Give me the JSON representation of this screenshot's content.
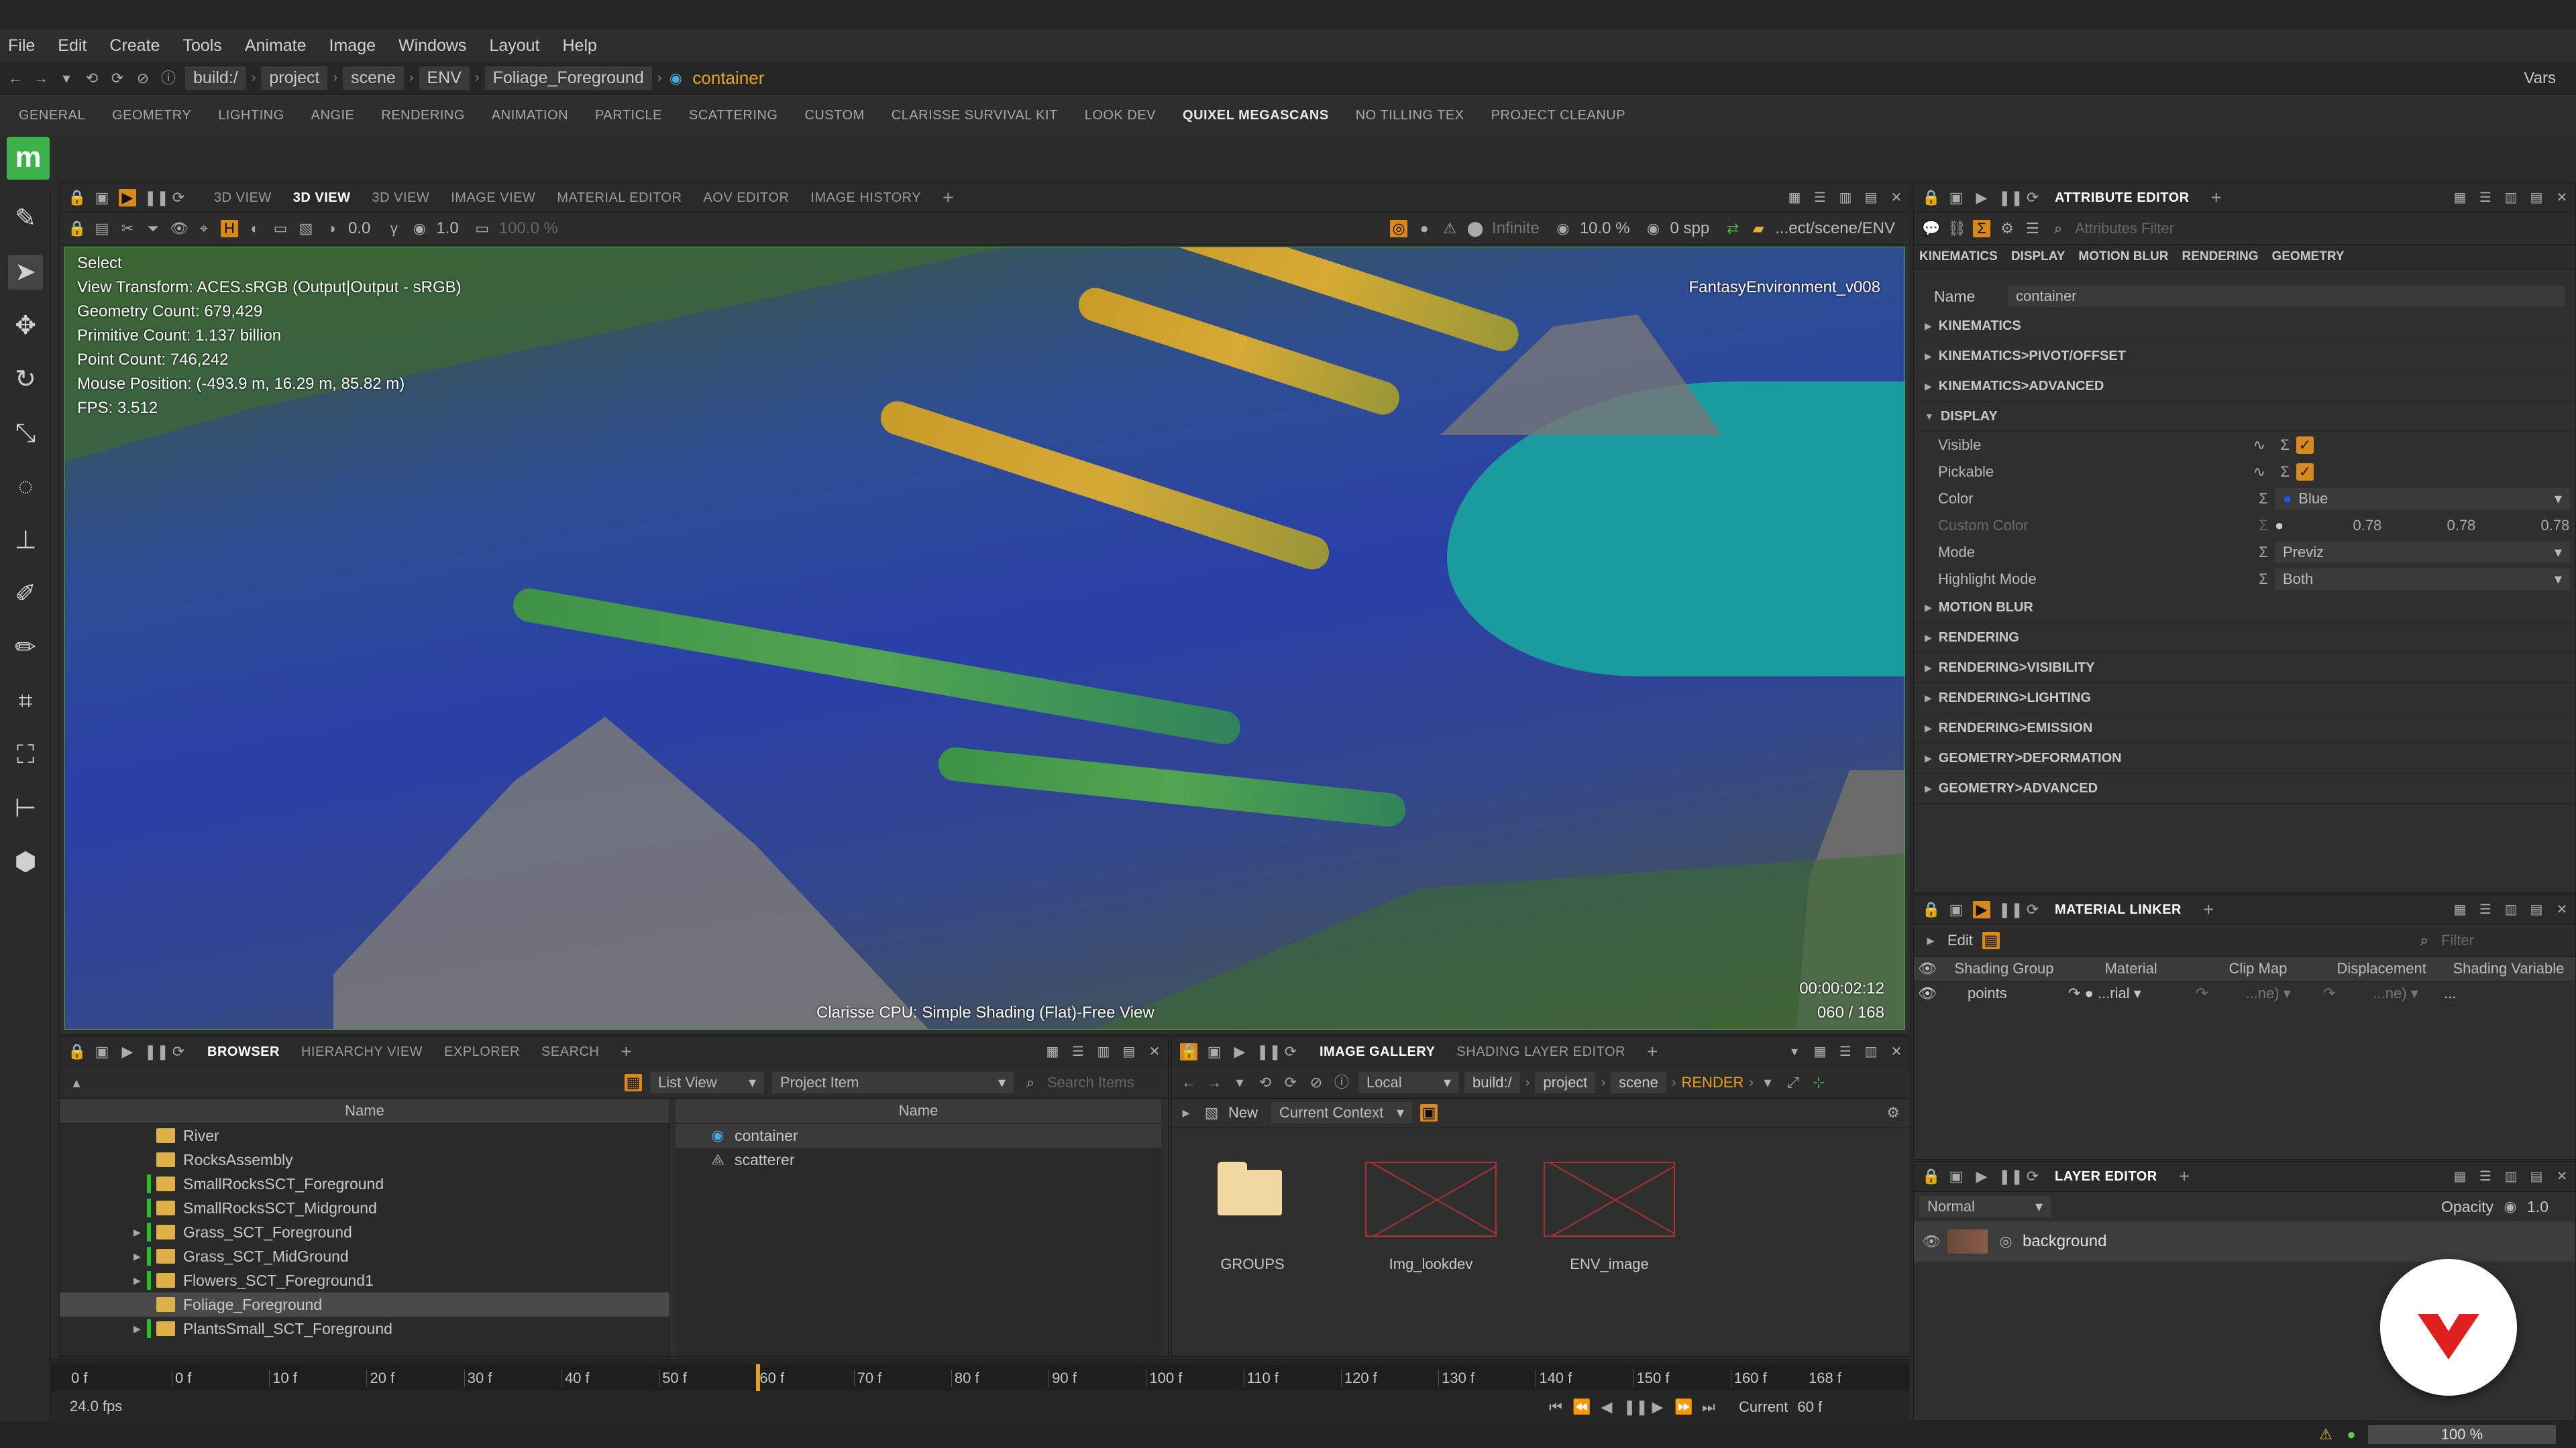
{
  "menu": [
    "File",
    "Edit",
    "Create",
    "Tools",
    "Animate",
    "Image",
    "Windows",
    "Layout",
    "Help"
  ],
  "path": {
    "items": [
      "build:/",
      "project",
      "scene",
      "ENV",
      "Foliage_Foreground"
    ],
    "current": "container",
    "vars": "Vars"
  },
  "shelf": [
    "GENERAL",
    "GEOMETRY",
    "LIGHTING",
    "ANGIE",
    "RENDERING",
    "ANIMATION",
    "PARTICLE",
    "SCATTERING",
    "CUSTOM",
    "CLARISSE SURVIVAL KIT",
    "LOOK DEV",
    "QUIXEL MEGASCANS",
    "NO TILLING TEX",
    "PROJECT CLEANUP"
  ],
  "shelf_active": "QUIXEL MEGASCANS",
  "logo_letter": "m",
  "viewport_panel": {
    "tabs": [
      "3D VIEW",
      "3D VIEW",
      "3D VIEW",
      "IMAGE VIEW",
      "MATERIAL EDITOR",
      "AOV EDITOR",
      "IMAGE HISTORY"
    ],
    "active_index": 1,
    "toolbar": {
      "val1": "0.0",
      "val2": "1.0",
      "val3": "100.0 %",
      "infinite": "Infinite",
      "percent": "10.0 %",
      "spp": "0 spp",
      "path": "...ect/scene/ENV"
    }
  },
  "viewport": {
    "mode": "Select",
    "info": [
      "View Transform: ACES.sRGB (Output|Output - sRGB)",
      "Geometry Count: 679,429",
      "Primitive Count: 1.137 billion",
      "Point Count: 746,242",
      "Mouse Position:  (-493.9 m, 16.29 m, 85.82 m)",
      "FPS: 3.512"
    ],
    "scene_name": "FantasyEnvironment_v008",
    "renderer": "Clarisse CPU: Simple Shading (Flat)-Free View",
    "time": "00:00:02:12",
    "frame": "060 / 168"
  },
  "attribute_editor": {
    "title": "ATTRIBUTE EDITOR",
    "filter_placeholder": "Attributes Filter",
    "subtabs": [
      "KINEMATICS",
      "DISPLAY",
      "MOTION BLUR",
      "RENDERING",
      "GEOMETRY"
    ],
    "name_label": "Name",
    "name_value": "container",
    "sections_top": [
      "KINEMATICS",
      "KINEMATICS>PIVOT/OFFSET",
      "KINEMATICS>ADVANCED"
    ],
    "display_section": "DISPLAY",
    "attrs": {
      "visible": "Visible",
      "pickable": "Pickable",
      "color": "Color",
      "color_value": "Blue",
      "custom_color": "Custom Color",
      "custom_r": "0.78",
      "custom_g": "0.78",
      "custom_b": "0.78",
      "mode": "Mode",
      "mode_value": "Previz",
      "highlight": "Highlight Mode",
      "highlight_value": "Both"
    },
    "sections_bottom": [
      "MOTION BLUR",
      "RENDERING",
      "RENDERING>VISIBILITY",
      "RENDERING>LIGHTING",
      "RENDERING>EMISSION",
      "GEOMETRY>DEFORMATION",
      "GEOMETRY>ADVANCED"
    ],
    "accent": "#d7891d"
  },
  "material_linker": {
    "title": "MATERIAL LINKER",
    "edit": "Edit",
    "filter_placeholder": "Filter",
    "columns": [
      "Shading Group",
      "Material",
      "Clip Map",
      "Displacement",
      "Shading Variable"
    ],
    "row": {
      "group": "points",
      "material": "...rial",
      "clip": "...ne)",
      "disp": "...ne)",
      "var": "..."
    }
  },
  "layer_editor": {
    "title": "LAYER EDITOR",
    "blend": "Normal",
    "opacity_label": "Opacity",
    "opacity_value": "1.0",
    "layer": "background"
  },
  "browser": {
    "tabs": [
      "BROWSER",
      "HIERARCHY VIEW",
      "EXPLORER",
      "SEARCH"
    ],
    "list_view": "List View",
    "project_item": "Project Item",
    "search_placeholder": "Search Items",
    "col_name": "Name",
    "tree": [
      {
        "label": "River",
        "green": false,
        "expand": false
      },
      {
        "label": "RocksAssembly",
        "green": false,
        "expand": false
      },
      {
        "label": "SmallRocksSCT_Foreground",
        "green": true,
        "expand": false
      },
      {
        "label": "SmallRocksSCT_Midground",
        "green": true,
        "expand": false
      },
      {
        "label": "Grass_SCT_Foreground",
        "green": true,
        "expand": true
      },
      {
        "label": "Grass_SCT_MidGround",
        "green": true,
        "expand": true
      },
      {
        "label": "Flowers_SCT_Foreground1",
        "green": true,
        "expand": true
      },
      {
        "label": "Foliage_Foreground",
        "green": false,
        "expand": false,
        "selected": true
      },
      {
        "label": "PlantsSmall_SCT_Foreground",
        "green": true,
        "expand": true
      }
    ],
    "items": [
      "container",
      "scatterer"
    ]
  },
  "gallery": {
    "tabs": [
      "IMAGE GALLERY",
      "SHADING LAYER EDITOR"
    ],
    "local": "Local",
    "path": [
      "build:/",
      "project",
      "scene"
    ],
    "render": "RENDER",
    "new_label": "New",
    "context": "Current Context",
    "thumbs": [
      "GROUPS",
      "Img_lookdev",
      "ENV_image"
    ]
  },
  "timeline": {
    "start": "0 f",
    "end": "168 f",
    "ticks": [
      "0 f",
      "10 f",
      "20 f",
      "30 f",
      "40 f",
      "50 f",
      "60 f",
      "70 f",
      "80 f",
      "90 f",
      "100 f",
      "110 f",
      "120 f",
      "130 f",
      "140 f",
      "150 f",
      "160 f"
    ],
    "fps": "24.0 fps",
    "current_label": "Current",
    "current_value": "60 f",
    "current_frame": 60,
    "frame_range": [
      0,
      168
    ]
  },
  "status": {
    "zoom": "100 %"
  }
}
